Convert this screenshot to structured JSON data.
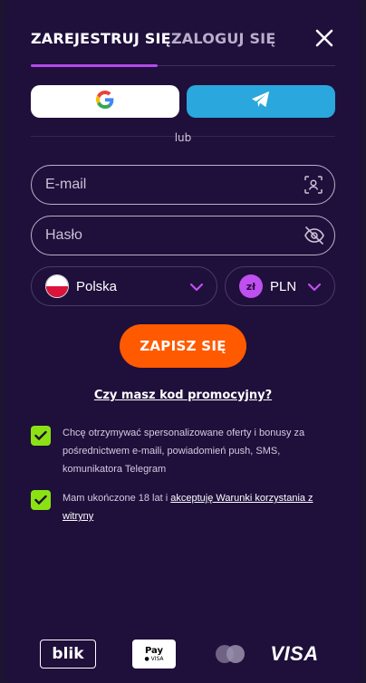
{
  "tabs": {
    "register": "ZAREJESTRUJ SIĘ",
    "login": "ZALOGUJ SIĘ"
  },
  "social": {
    "google_icon": "google-g-icon",
    "telegram_icon": "telegram-plane-icon",
    "or_label": "lub"
  },
  "form": {
    "email_placeholder": "E-mail",
    "password_placeholder": "Hasło",
    "country": "Polska",
    "currency_symbol": "zł",
    "currency": "PLN",
    "submit": "ZAPISZ SIĘ",
    "promo": "Czy masz kod promocyjny?"
  },
  "consents": {
    "marketing": "Chcę otrzymywać spersonalizowane oferty i bonusy za pośrednictwem e-maili, powiadomień push, SMS, komunikatora Telegram",
    "terms_prefix": "Mam ukończone 18 lat i ",
    "terms_link": "akceptuję Warunki korzystania z witryny"
  },
  "payments": {
    "blik": "blik",
    "applepay": "Pay",
    "applepay_sub": "● VISA",
    "visa": "VISA"
  },
  "colors": {
    "accent_purple": "#b24be8",
    "submit_orange": "#ff5a00",
    "checkbox_green": "#8be213",
    "telegram_blue": "#2aa7dc"
  }
}
